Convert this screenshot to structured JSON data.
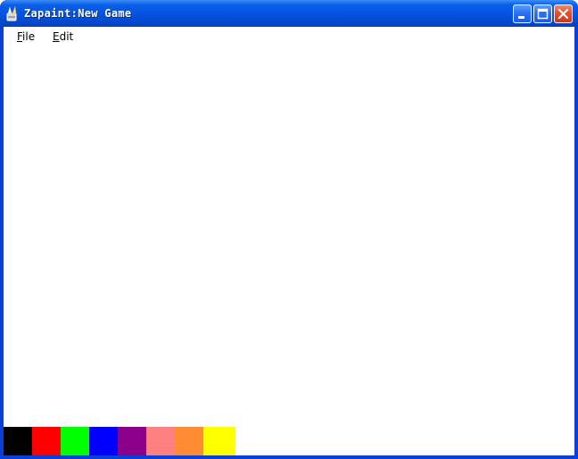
{
  "window": {
    "title": "Zapaint:New Game",
    "icon": "paintbrush-icon"
  },
  "title_buttons": {
    "minimize": "minimize-icon",
    "maximize": "maximize-icon",
    "close": "close-icon"
  },
  "menu": {
    "items": [
      {
        "label_first": "F",
        "label_rest": "ile"
      },
      {
        "label_first": "E",
        "label_rest": "dit"
      }
    ]
  },
  "palette": {
    "colors": [
      "#000000",
      "#ff0000",
      "#00ff00",
      "#0000ff",
      "#8b008b",
      "#ff8080",
      "#ff8c32",
      "#ffff00"
    ]
  }
}
